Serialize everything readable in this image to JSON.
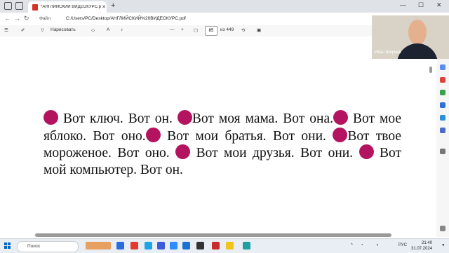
{
  "browser": {
    "tab_title": "*АНГЛИЙСКИЙ ВИДЕОКУРС.pdf",
    "close_glyph": "✕",
    "new_tab_glyph": "+",
    "window_controls": [
      "—",
      "☐",
      "✕"
    ]
  },
  "address_bar": {
    "file_label": "Файл",
    "url": "C:/Users/PC/Desktop/АНГЛИЙСКИЙ%20ВИДЕОКУРС.pdf"
  },
  "pdf_toolbar": {
    "draw_label": "Нарисовать",
    "zoom_out": "—",
    "zoom_in": "+",
    "current_page": "85",
    "total_pages": "из 449"
  },
  "document": {
    "sentences": [
      "Вот ключ. Вот он.",
      "Вот моя мама. Вот она.",
      "Вот мое яблоко. Вот оно.",
      "Вот мои братья. Вот они.",
      "Вот твое мороженое. Вот оно.",
      "Вот мои друзья. Вот они.",
      "Вот мой компьютер. Вот он."
    ],
    "bullet_color": "#b3135f"
  },
  "webcam": {
    "person_name": "Иван Ширяев"
  },
  "taskbar": {
    "search_placeholder": "Поиск",
    "language": "РУС",
    "time": "21:40",
    "date": "31.07.2024"
  }
}
